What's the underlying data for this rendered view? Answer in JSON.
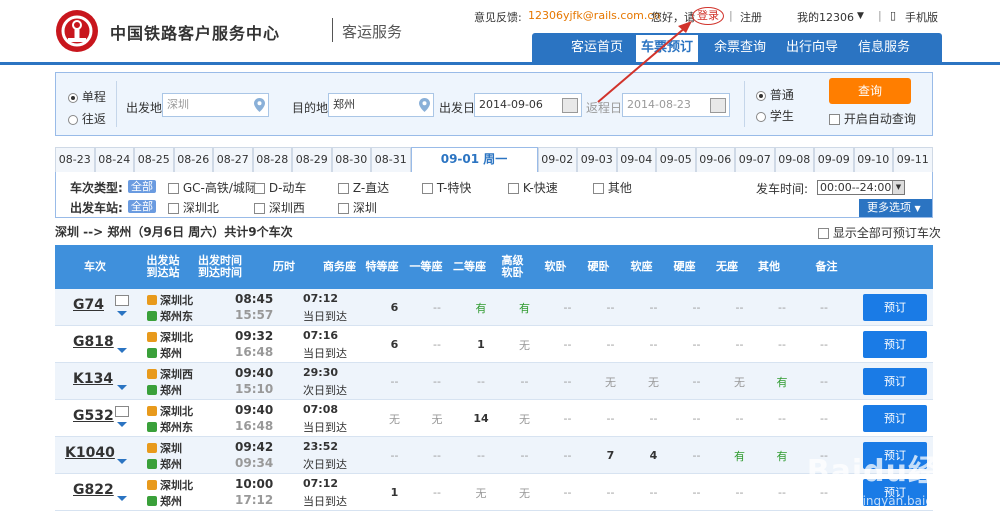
{
  "header": {
    "brand": "中国铁路客户服务中心",
    "sub": "客运服务",
    "feedback_label": "意见反馈:",
    "feedback_email": "12306yjfk@rails.com.cn",
    "greeting": "您好，请",
    "login": "登录",
    "register": "注册",
    "my12306": "我的12306",
    "mobile": "手机版"
  },
  "nav": [
    "客运首页",
    "车票预订",
    "余票查询",
    "出行向导",
    "信息服务"
  ],
  "search": {
    "one_way": "单程",
    "round_trip": "往返",
    "from_label": "出发地",
    "from_value": "深圳",
    "to_label": "目的地",
    "to_value": "郑州",
    "depart_label": "出发日",
    "depart_value": "2014-09-06",
    "return_label": "返程日",
    "return_value": "2014-08-23",
    "normal": "普通",
    "student": "学生",
    "query_button": "查询",
    "auto_query": "开启自动查询"
  },
  "dates": [
    "08-23",
    "08-24",
    "08-25",
    "08-26",
    "08-27",
    "08-28",
    "08-29",
    "08-30",
    "08-31",
    "09-01 周一",
    "09-02",
    "09-03",
    "09-04",
    "09-05",
    "09-06",
    "09-07",
    "09-08",
    "09-09",
    "09-10",
    "09-11"
  ],
  "filters": {
    "type_label": "车次类型:",
    "station_label": "出发车站:",
    "all": "全部",
    "types": [
      "GC-高铁/城际",
      "D-动车",
      "Z-直达",
      "T-特快",
      "K-快速",
      "其他"
    ],
    "stations": [
      "深圳北",
      "深圳西",
      "深圳"
    ],
    "time_label": "发车时间:",
    "time_value": "00:00--24:00",
    "more": "更多选项"
  },
  "summary": "深圳 --> 郑州（9月6日  周六）共计9个车次",
  "show_all": "显示全部可预订车次",
  "columns": [
    "车次",
    "出发站\n到达站",
    "出发时间\n到达时间",
    "历时",
    "商务座",
    "特等座",
    "一等座",
    "二等座",
    "高级\n软卧",
    "软卧",
    "硬卧",
    "软座",
    "硬座",
    "无座",
    "其他",
    "备注"
  ],
  "rows": [
    {
      "no": "G74",
      "from": "深圳北",
      "to": "郑州东",
      "dep": "08:45",
      "arr": "15:57",
      "dur": "07:12",
      "day": "当日到达",
      "seats": [
        "6",
        "--",
        "有",
        "有",
        "--",
        "--",
        "--",
        "--",
        "--",
        "--",
        "--"
      ],
      "book": "预订",
      "card": true
    },
    {
      "no": "G818",
      "from": "深圳北",
      "to": "郑州",
      "dep": "09:32",
      "arr": "16:48",
      "dur": "07:16",
      "day": "当日到达",
      "seats": [
        "6",
        "--",
        "1",
        "无",
        "--",
        "--",
        "--",
        "--",
        "--",
        "--",
        "--"
      ],
      "book": "预订",
      "card": false
    },
    {
      "no": "K134",
      "from": "深圳西",
      "to": "郑州",
      "dep": "09:40",
      "arr": "15:10",
      "dur": "29:30",
      "day": "次日到达",
      "seats": [
        "--",
        "--",
        "--",
        "--",
        "--",
        "无",
        "无",
        "--",
        "无",
        "有",
        "--"
      ],
      "book": "预订",
      "card": false
    },
    {
      "no": "G532",
      "from": "深圳北",
      "to": "郑州东",
      "dep": "09:40",
      "arr": "16:48",
      "dur": "07:08",
      "day": "当日到达",
      "seats": [
        "无",
        "无",
        "14",
        "无",
        "--",
        "--",
        "--",
        "--",
        "--",
        "--",
        "--"
      ],
      "book": "预订",
      "card": true
    },
    {
      "no": "K1040",
      "from": "深圳",
      "to": "郑州",
      "dep": "09:42",
      "arr": "09:34",
      "dur": "23:52",
      "day": "次日到达",
      "seats": [
        "--",
        "--",
        "--",
        "--",
        "--",
        "7",
        "4",
        "--",
        "有",
        "有",
        "--"
      ],
      "book": "预订",
      "card": false
    },
    {
      "no": "G822",
      "from": "深圳北",
      "to": "郑州",
      "dep": "10:00",
      "arr": "17:12",
      "dur": "07:12",
      "day": "当日到达",
      "seats": [
        "1",
        "--",
        "无",
        "无",
        "--",
        "--",
        "--",
        "--",
        "--",
        "--",
        "--"
      ],
      "book": "预订",
      "card": false
    }
  ],
  "watermark": {
    "main": "Baidu经验",
    "sub": "jingyan.baidu.com"
  }
}
